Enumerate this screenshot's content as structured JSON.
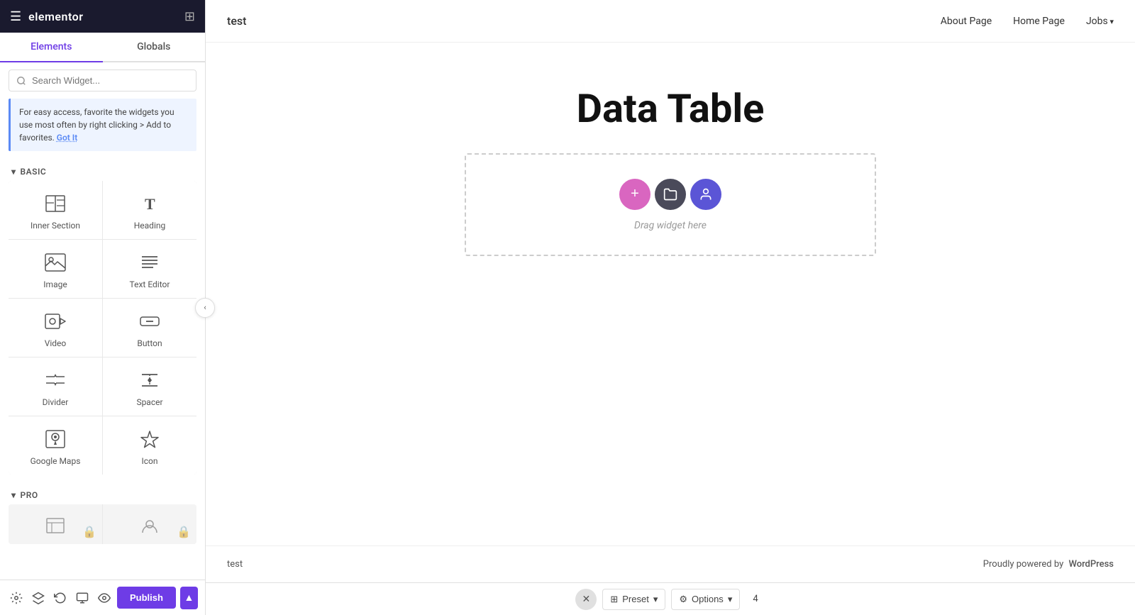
{
  "sidebar": {
    "logo": "elementor",
    "tabs": [
      {
        "id": "elements",
        "label": "Elements",
        "active": true
      },
      {
        "id": "globals",
        "label": "Globals",
        "active": false
      }
    ],
    "search_placeholder": "Search Widget...",
    "info_box": {
      "text": "For easy access, favorite the widgets you use most often by right clicking > Add to favorites.",
      "link_text": "Got It"
    },
    "sections": [
      {
        "label": "Basic",
        "widgets": [
          {
            "id": "inner-section",
            "label": "Inner Section",
            "icon": "inner-section"
          },
          {
            "id": "heading",
            "label": "Heading",
            "icon": "heading"
          },
          {
            "id": "image",
            "label": "Image",
            "icon": "image"
          },
          {
            "id": "text-editor",
            "label": "Text Editor",
            "icon": "text-editor"
          },
          {
            "id": "video",
            "label": "Video",
            "icon": "video"
          },
          {
            "id": "button",
            "label": "Button",
            "icon": "button"
          },
          {
            "id": "divider",
            "label": "Divider",
            "icon": "divider"
          },
          {
            "id": "spacer",
            "label": "Spacer",
            "icon": "spacer"
          },
          {
            "id": "google-maps",
            "label": "Google Maps",
            "icon": "google-maps"
          },
          {
            "id": "icon",
            "label": "Icon",
            "icon": "icon"
          }
        ]
      },
      {
        "label": "Pro",
        "widgets": []
      }
    ],
    "bottom_icons": [
      "settings",
      "layers",
      "history",
      "responsive",
      "visibility"
    ],
    "publish_label": "Publish",
    "chevron_label": "▲"
  },
  "canvas": {
    "site_header": {
      "logo": "test",
      "nav_items": [
        {
          "label": "About Page",
          "has_arrow": false
        },
        {
          "label": "Home Page",
          "has_arrow": false
        },
        {
          "label": "Jobs",
          "has_arrow": true
        }
      ]
    },
    "page_title": "Data Table",
    "drop_zone": {
      "drag_text": "Drag widget here"
    },
    "site_footer": {
      "logo": "test",
      "powered_text": "Proudly powered by",
      "powered_link": "WordPress"
    }
  },
  "bottom_toolbar": {
    "preset_label": "Preset",
    "options_label": "Options",
    "page_number": "4"
  },
  "colors": {
    "accent": "#6e3ce6",
    "add_btn": "#d966c0",
    "folder_btn": "#4a4a5a",
    "person_btn": "#5b55d6"
  }
}
